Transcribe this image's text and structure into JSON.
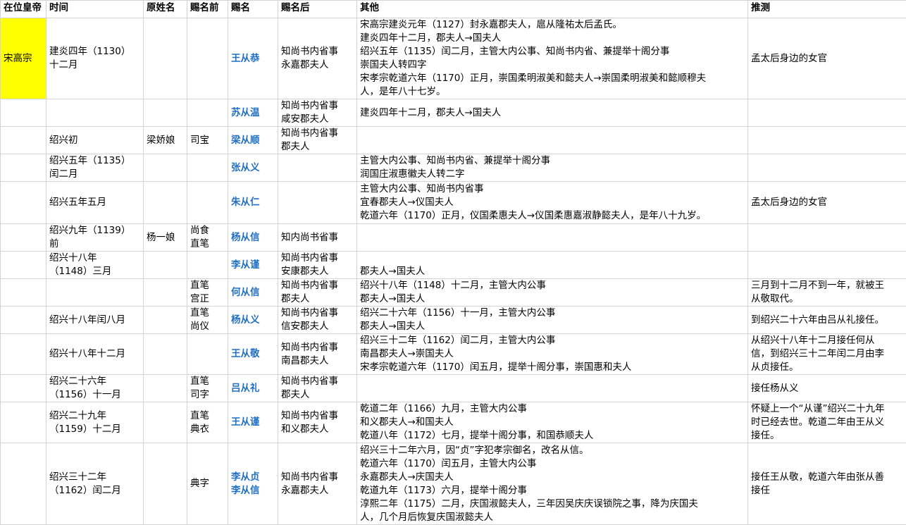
{
  "headers": [
    "在位皇帝",
    "时间",
    "原姓名",
    "赐名前",
    "赐名",
    "赐名后",
    "其他",
    "推测"
  ],
  "rows": [
    {
      "emperor": "宋高宗",
      "time": "建炎四年（1130）\n十二月",
      "orig": "",
      "before": "",
      "name": "王从恭",
      "after": "知尚书内省事\n永嘉郡夫人",
      "other": "宋高宗建炎元年（1127）封永嘉郡夫人，扈从隆祐太后孟氏。\n建炎四年十二月，郡夫人→国夫人\n绍兴五年（1135）闰二月，主管大内公事、知尚书内省、兼提举十阁分事\n崇国夫人转四字\n宋孝宗乾道六年（1170）正月，崇国柔明淑美和懿夫人→崇国柔明淑美和懿顺穆夫\n人，是年八十七岁。",
      "guess": "孟太后身边的女官"
    },
    {
      "emperor": "",
      "time": "",
      "orig": "",
      "before": "",
      "name": "苏从温",
      "after": "知尚书内省事\n咸安郡夫人",
      "other": "建炎四年十二月，郡夫人→国夫人",
      "guess": ""
    },
    {
      "emperor": "",
      "time": "绍兴初",
      "orig": "梁娇娘",
      "before": "司宝",
      "name": "梁从顺",
      "after": "知尚书内省事\n郡夫人",
      "other": "",
      "guess": ""
    },
    {
      "emperor": "",
      "time": "绍兴五年（1135）\n闰二月",
      "orig": "",
      "before": "",
      "name": "张从义",
      "after": "",
      "other": "主管大内公事、知尚书内省、兼提举十阁分事\n润国庄淑惠徽夫人转二字",
      "guess": ""
    },
    {
      "emperor": "",
      "time": "绍兴五年五月",
      "orig": "",
      "before": "",
      "name": "朱从仁",
      "after": "",
      "other": "主管大内公事、知尚书内省事\n宜春郡夫人→仪国夫人\n乾道六年（1170）正月，仪国柔惠夫人→仪国柔惠嘉淑静懿夫人，是年八十九岁。",
      "guess": "孟太后身边的女官"
    },
    {
      "emperor": "",
      "time": "绍兴九年（1139）\n前",
      "orig": "杨一娘",
      "before": "尚食\n直笔",
      "name": "杨从信",
      "after": "知内尚书省事",
      "other": "",
      "guess": ""
    },
    {
      "emperor": "",
      "time": "绍兴十八年\n（1148）三月",
      "orig": "",
      "before": "",
      "name": "李从谨",
      "after": "知尚书内省事\n安康郡夫人",
      "other": "郡夫人→国夫人",
      "guess": ""
    },
    {
      "emperor": "",
      "time": "",
      "orig": "",
      "before": "直笔\n宫正",
      "name": "何从信",
      "after": "知尚书内省事\n郡夫人",
      "other": "绍兴十八年（1148）十二月，主管大内公事\n郡夫人→国夫人",
      "guess": "三月到十二月不到一年，就被王\n从敬取代。"
    },
    {
      "emperor": "",
      "time": "绍兴十八年闰八月",
      "orig": "",
      "before": "直笔\n尚仪",
      "name": "杨从义",
      "after": "知尚书内省事\n信安郡夫人",
      "other": "绍兴二十六年（1156）十一月，主管大内公事\n郡夫人→国夫人",
      "guess": "到绍兴二十六年由吕从礼接任。"
    },
    {
      "emperor": "",
      "time": "绍兴十八年十二月",
      "orig": "",
      "before": "",
      "name": "王从敬",
      "after": "知尚书内省事\n南昌郡夫人",
      "other": "绍兴三十二年（1162）闰二月，主管大内公事\n南昌郡夫人→崇国夫人\n宋孝宗乾道六年（1170）闰五月，提举十阁分事，崇国惠和夫人",
      "guess": "从绍兴十八年十二月接任何从\n信，到绍兴三十二年闰二月由李\n从贞接任。"
    },
    {
      "emperor": "",
      "time": "绍兴二十六年\n（1156）十一月",
      "orig": "",
      "before": "直笔\n司字",
      "name": "吕从礼",
      "after": "知尚书内省事\n郡夫人",
      "other": "",
      "guess": "接任杨从义"
    },
    {
      "emperor": "",
      "time": "绍兴二十九年\n（1159）十二月",
      "orig": "",
      "before": "直笔\n典衣",
      "name": "王从谨",
      "after": "知尚书内省事\n和义郡夫人",
      "other": "乾道二年（1166）九月，主管大内公事\n和义郡夫人→和国夫人\n乾道八年（1172）七月，提举十阁分事，和国恭顺夫人",
      "guess": "怀疑上一个“从谨”绍兴二十九年\n时已经去世。乾道二年由王从义\n接任。"
    },
    {
      "emperor": "",
      "time": "绍兴三十二年\n（1162）闰二月",
      "orig": "",
      "before": "典字",
      "name": "李从贞\n李从信",
      "after": "知尚书内省事\n永嘉郡夫人",
      "other": "绍兴三十二年六月，因“贞”字犯孝宗御名，改名从信。\n乾道六年（1170）闰五月，主管大内公事\n永嘉郡夫人→庆国夫人\n乾道九年（1173）六月，提举十阁分事\n淳熙二年（1175）二月，庆国淑懿夫人，三年因吴庆庆误锁院之事，降为庆国夫\n人，几个月后恢复庆国淑懿夫人",
      "guess": "接任王从敬，乾道六年由张从善\n接任"
    }
  ]
}
